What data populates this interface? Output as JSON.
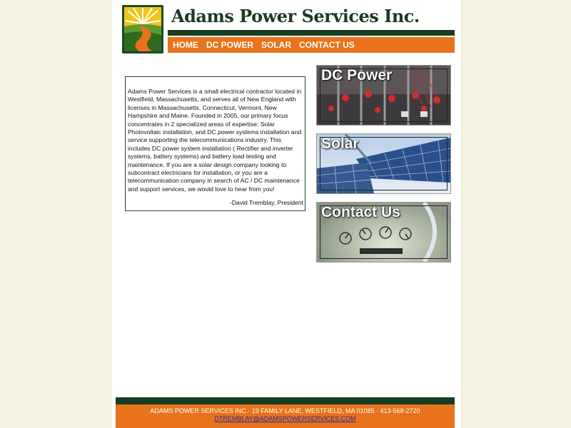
{
  "header": {
    "title": "Adams Power Services Inc."
  },
  "nav": {
    "items": [
      "HOME",
      "DC POWER",
      "SOLAR",
      "CONTACT US"
    ]
  },
  "intro": {
    "text": "Adams Power Services is a small electrical contractor located in Westfield, Massachusetts, and serves all of New England with licenses in Massachusetts, Connecticut, Vermont, New Hampshire and Maine. Founded in 2005, our primary focus concentrates in 2 specialized areas of expertise: Solar Photovoltaic installation, and DC power systems installation and service supporting the telecommunications industry. This includes DC power system installation ( Rectifier and inverter systems, battery systems) and battery load testing and maintenance. If you are a solar design company looking to subcontract electricians for installation, or you are a telecommunication company in search of AC / DC maintenance and support services, we would love to hear from you!",
    "signature": "-David Tremblay, President"
  },
  "tiles": [
    {
      "label": "DC Power",
      "icon": "dc-power-equipment-photo"
    },
    {
      "label": "Solar",
      "icon": "solar-panel-photo"
    },
    {
      "label": "Contact Us",
      "icon": "electric-meter-photo"
    }
  ],
  "footer": {
    "address": "ADAMS POWER SERVICES INC.· 19 FAMILY LANE, WESTFIELD, MA 01085 · 413-568-2720",
    "email": "DTREMBLAY@ADAMSPOWERSERVICES.COM"
  },
  "colors": {
    "brand_green": "#173d20",
    "brand_orange": "#e8731c",
    "page_background": "#f5f2df"
  }
}
